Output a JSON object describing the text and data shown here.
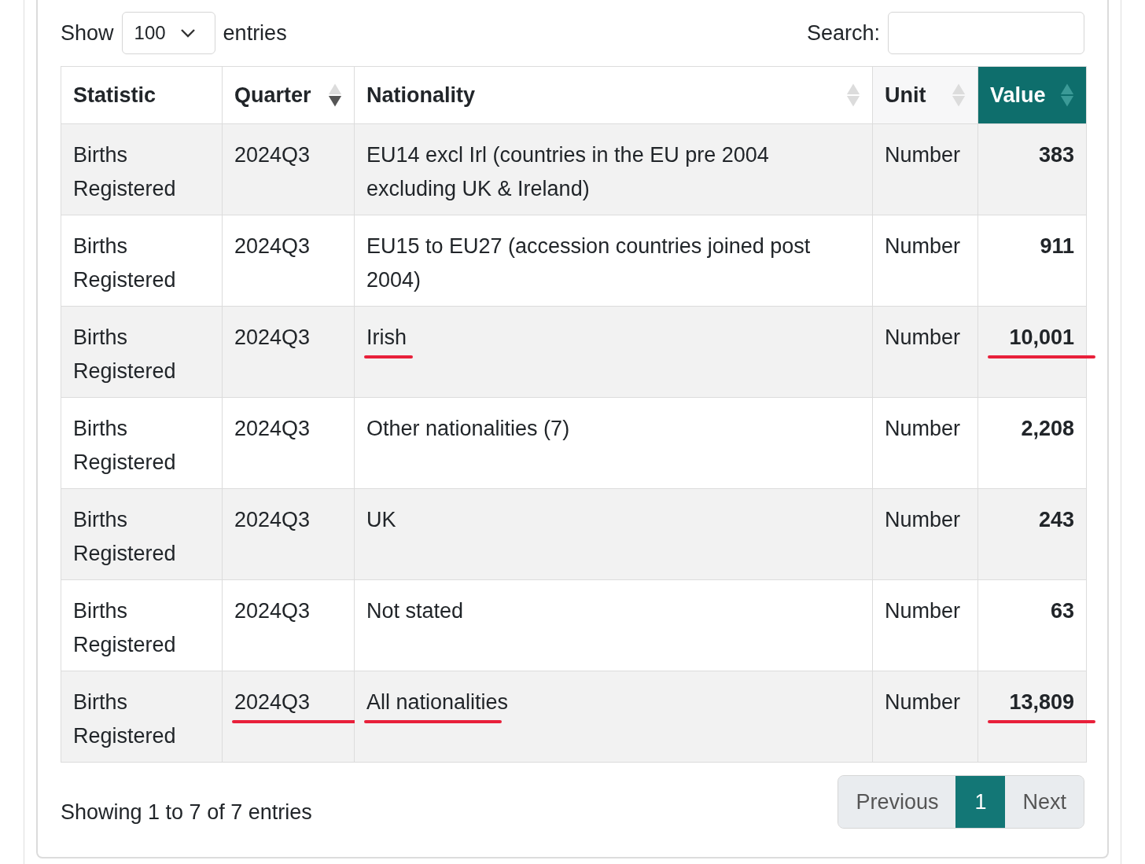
{
  "length_control": {
    "label_before": "Show",
    "value": "100",
    "label_after": "entries"
  },
  "search": {
    "label": "Search:"
  },
  "table": {
    "columns": [
      {
        "label": "Statistic",
        "sortable": false,
        "selected": false
      },
      {
        "label": "Quarter",
        "sortable": true,
        "sorted": true,
        "selected": false
      },
      {
        "label": "Nationality",
        "sortable": true,
        "sorted": false,
        "selected": false
      },
      {
        "label": "Unit",
        "sortable": true,
        "sorted": false,
        "selected": false
      },
      {
        "label": "Value",
        "sortable": true,
        "sorted": false,
        "selected": true
      }
    ],
    "rows": [
      [
        {
          "text": "Births Registered"
        },
        {
          "text": "2024Q3"
        },
        {
          "text": "EU14 excl Irl (countries in the EU pre 2004 excluding UK & Ireland)"
        },
        {
          "text": "Number"
        },
        {
          "text": "383"
        }
      ],
      [
        {
          "text": "Births Registered"
        },
        {
          "text": "2024Q3"
        },
        {
          "text": "EU15 to EU27 (accession countries joined post 2004)"
        },
        {
          "text": "Number"
        },
        {
          "text": "911"
        }
      ],
      [
        {
          "text": "Births Registered"
        },
        {
          "text": "2024Q3"
        },
        {
          "text": "Irish",
          "underlined": true
        },
        {
          "text": "Number"
        },
        {
          "text": "10,001",
          "underlined": true
        }
      ],
      [
        {
          "text": "Births Registered"
        },
        {
          "text": "2024Q3"
        },
        {
          "text": "Other nationalities (7)"
        },
        {
          "text": "Number"
        },
        {
          "text": "2,208"
        }
      ],
      [
        {
          "text": "Births Registered"
        },
        {
          "text": "2024Q3"
        },
        {
          "text": "UK"
        },
        {
          "text": "Number"
        },
        {
          "text": "243"
        }
      ],
      [
        {
          "text": "Births Registered"
        },
        {
          "text": "2024Q3"
        },
        {
          "text": "Not stated"
        },
        {
          "text": "Number"
        },
        {
          "text": "63"
        }
      ],
      [
        {
          "text": "Births Registered"
        },
        {
          "text": "2024Q3",
          "underlined": true
        },
        {
          "text": "All nationalities",
          "underlined": true
        },
        {
          "text": "Number"
        },
        {
          "text": "13,809",
          "underlined": true
        }
      ]
    ]
  },
  "info": "Showing 1 to 7 of 7 entries",
  "pagination": [
    {
      "label": "Previous",
      "selected": false
    },
    {
      "label": "1",
      "selected": true
    },
    {
      "label": "Next",
      "selected": false
    }
  ]
}
